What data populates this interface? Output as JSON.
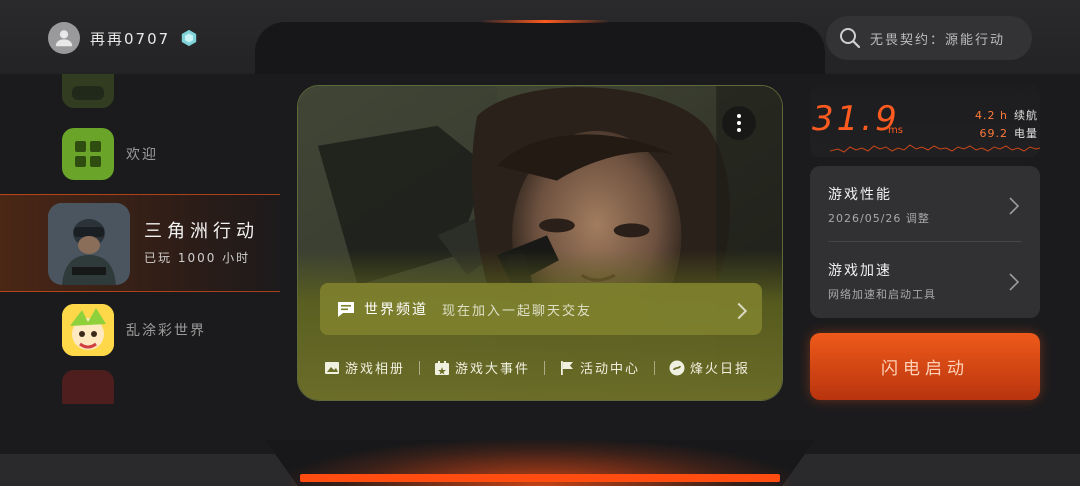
{
  "header": {
    "username": "再再0707",
    "search_placeholder": "无畏契约：源能行动"
  },
  "games": [
    {
      "label": "",
      "icon": "controller-icon",
      "faded": true
    },
    {
      "label": "欢迎",
      "icon": "grid-apps-icon"
    },
    {
      "label": "三角洲行动",
      "playtime": "已玩 1000 小时",
      "active": true
    },
    {
      "label": "乱涂彩世界"
    },
    {
      "label": "",
      "faded": true
    }
  ],
  "banner": {
    "channel_title": "世界频道",
    "channel_desc": "现在加入一起聊天交友",
    "links": [
      "游戏相册",
      "游戏大事件",
      "活动中心",
      "烽火日报"
    ]
  },
  "stats": {
    "ping": "31.9",
    "ping_unit": "ms",
    "battery_life_value": "4.2 h",
    "battery_life_label": "续航",
    "battery_value": "69.2",
    "battery_label": "电量",
    "accent": "#ff5a1f"
  },
  "panel": {
    "performance_title": "游戏性能",
    "performance_sub": "2026/05/26 调整",
    "boost_title": "游戏加速",
    "boost_sub": "网络加速和启动工具",
    "launch_label": "闪电启动"
  }
}
